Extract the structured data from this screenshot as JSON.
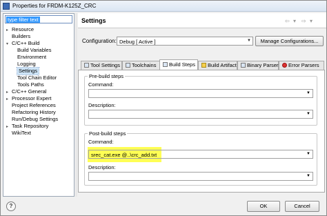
{
  "window": {
    "title": "Properties for FRDM-K125Z_CRC"
  },
  "filter": {
    "placeholder": "type filter text"
  },
  "tree": [
    {
      "label": "Resource",
      "expander": "▸"
    },
    {
      "label": "Builders",
      "expander": ""
    },
    {
      "label": "C/C++ Build",
      "expander": "▾"
    },
    {
      "label": "Build Variables",
      "expander": ""
    },
    {
      "label": "Environment",
      "expander": ""
    },
    {
      "label": "Logging",
      "expander": ""
    },
    {
      "label": "Settings",
      "expander": ""
    },
    {
      "label": "Tool Chain Editor",
      "expander": ""
    },
    {
      "label": "Tools Paths",
      "expander": ""
    },
    {
      "label": "C/C++ General",
      "expander": "▸"
    },
    {
      "label": "Processor Expert",
      "expander": "▸"
    },
    {
      "label": "Project References",
      "expander": ""
    },
    {
      "label": "Refactoring History",
      "expander": ""
    },
    {
      "label": "Run/Debug Settings",
      "expander": ""
    },
    {
      "label": "Task Repository",
      "expander": "▸"
    },
    {
      "label": "WikiText",
      "expander": ""
    }
  ],
  "header": {
    "title": "Settings",
    "back": "⇦",
    "fwd": "⇨",
    "menu": "▾"
  },
  "config": {
    "label": "Configuration:",
    "value": "Debug  [ Active ]",
    "manage_button": "Manage Configurations..."
  },
  "tabs": [
    {
      "label": "Tool Settings",
      "icon": "tool-settings-icon"
    },
    {
      "label": "Toolchains",
      "icon": "toolchains-icon"
    },
    {
      "label": "Build Steps",
      "icon": "build-steps-icon"
    },
    {
      "label": "Build Artifact",
      "icon": "build-artifact-icon"
    },
    {
      "label": "Binary Parsers",
      "icon": "binary-parsers-icon"
    },
    {
      "label": "Error Parsers",
      "icon": "error-parsers-icon"
    }
  ],
  "prebuild": {
    "legend": "Pre-build steps",
    "command_label": "Command:",
    "command_value": "",
    "description_label": "Description:",
    "description_value": ""
  },
  "postbuild": {
    "legend": "Post-build steps",
    "command_label": "Command:",
    "command_value": "srec_cat.exe @..\\crc_add.txt",
    "description_label": "Description:",
    "description_value": ""
  },
  "buttons": {
    "ok": "OK",
    "cancel": "Cancel",
    "help": "?"
  },
  "colors": {
    "highlight": "#ffff55",
    "selection": "#3399ff"
  }
}
